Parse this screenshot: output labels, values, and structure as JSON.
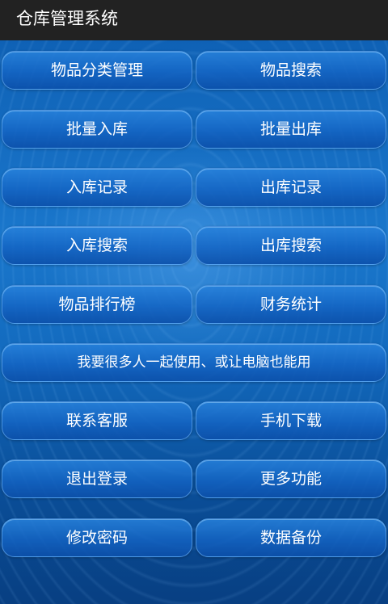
{
  "app": {
    "title": "仓库管理系统"
  },
  "menu": {
    "item_management": "物品分类管理",
    "item_search": "物品搜索",
    "batch_inbound": "批量入库",
    "batch_outbound": "批量出库",
    "inbound_records": "入库记录",
    "outbound_records": "出库记录",
    "inbound_search": "入库搜索",
    "outbound_search": "出库搜索",
    "item_ranking": "物品排行榜",
    "finance_stats": "财务统计",
    "multi_user": "我要很多人一起使用、或让电脑也能用",
    "contact_support": "联系客服",
    "mobile_download": "手机下载",
    "logout": "退出登录",
    "more_features": "更多功能",
    "change_password": "修改密码",
    "data_backup": "数据备份"
  }
}
